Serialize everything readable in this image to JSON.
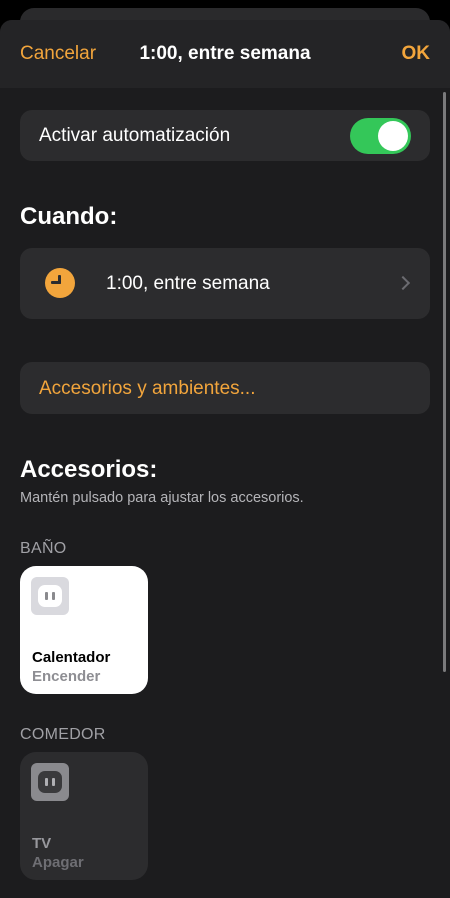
{
  "nav": {
    "cancel_label": "Cancelar",
    "title": "1:00, entre semana",
    "ok_label": "OK"
  },
  "automation": {
    "label": "Activar automatización",
    "enabled": true
  },
  "when": {
    "section_title": "Cuando:",
    "trigger_label": "1:00, entre semana"
  },
  "accessories_link": {
    "label": "Accesorios y ambientes..."
  },
  "accessories": {
    "section_title": "Accesorios:",
    "hint": "Mantén pulsado para ajustar los accesorios.",
    "rooms": [
      {
        "name": "BAÑO",
        "items": [
          {
            "name": "Calentador",
            "action": "Encender"
          }
        ]
      },
      {
        "name": "COMEDOR",
        "items": [
          {
            "name": "TV",
            "action": "Apagar"
          }
        ]
      }
    ]
  },
  "colors": {
    "accent": "#f2a53c",
    "toggle_on": "#34c759",
    "background": "#1c1c1e",
    "card": "#2c2c2e"
  },
  "icons": {
    "clock": "clock-icon",
    "outlet": "outlet-icon",
    "chevron": "chevron-right-icon"
  }
}
